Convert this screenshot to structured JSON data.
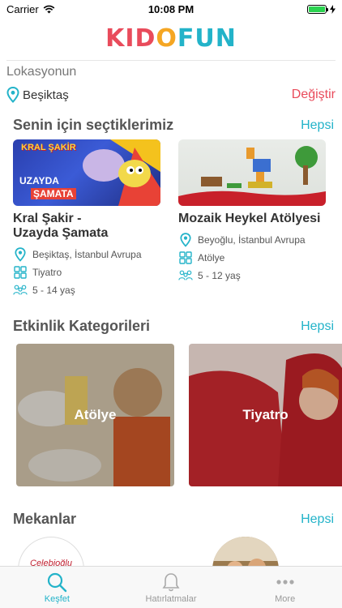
{
  "status_bar": {
    "carrier": "Carrier",
    "time": "10:08 PM"
  },
  "logo": {
    "part1": "KID",
    "part2": "O",
    "part3": "FUN"
  },
  "location": {
    "label": "Lokasyonun",
    "value": "Beşiktaş",
    "change": "Değiştir"
  },
  "picks": {
    "title": "Senin için seçtiklerimiz",
    "all": "Hepsi",
    "items": [
      {
        "image_text_top": "KRAL ŞAKİR",
        "image_text_bottom1": "UZAYDA",
        "image_text_bottom2": "ŞAMATA",
        "title_line1": "Kral Şakir -",
        "title_line2": "Uzayda Şamata",
        "place": "Beşiktaş, İstanbul Avrupa",
        "category": "Tiyatro",
        "age": "5 - 14 yaş"
      },
      {
        "title_line1": "Mozaik Heykel Atölyesi",
        "title_line2": "",
        "place": "Beyoğlu, İstanbul Avrupa",
        "category": "Atölye",
        "age": "5 - 12 yaş"
      }
    ]
  },
  "categories": {
    "title": "Etkinlik Kategorileri",
    "all": "Hepsi",
    "items": [
      {
        "label": "Atölye"
      },
      {
        "label": "Tiyatro"
      }
    ]
  },
  "venues": {
    "title": "Mekanlar",
    "all": "Hepsi",
    "first_logo_text": "Çelebioğlu"
  },
  "tabs": [
    {
      "label": "Keşfet"
    },
    {
      "label": "Hatırlatmalar"
    },
    {
      "label": "More"
    }
  ],
  "colors": {
    "accent": "#23b3c9",
    "brand_red": "#e94b5b",
    "brand_yellow": "#f5a623"
  }
}
